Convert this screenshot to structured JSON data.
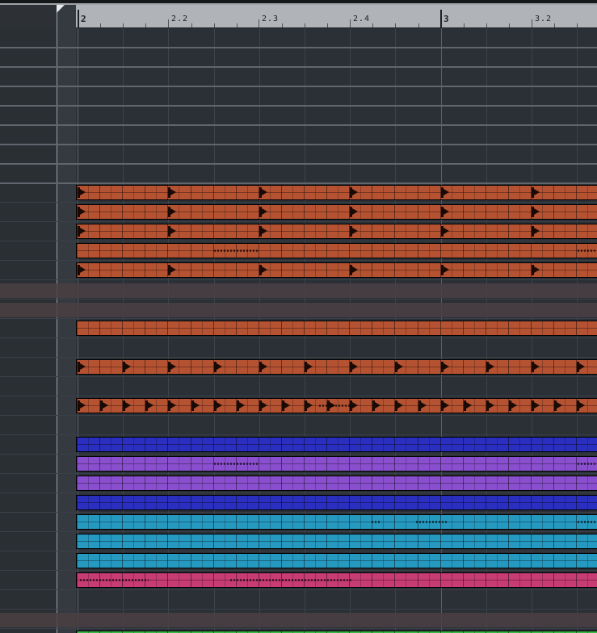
{
  "ruler": {
    "markers": [
      {
        "label": "2",
        "bar": true
      },
      {
        "label": "2.2",
        "bar": false
      },
      {
        "label": "2.3",
        "bar": false
      },
      {
        "label": "2.4",
        "bar": false
      },
      {
        "label": "3",
        "bar": true
      },
      {
        "label": "3.2",
        "bar": false
      }
    ]
  },
  "colors": {
    "orange": "#b55232",
    "blue": "#2a2fc0",
    "purple": "#8a4fcf",
    "cyan": "#2699c0",
    "pink": "#c83c74",
    "green": "#3cb84a",
    "band": "#4a3f43"
  },
  "tracks": [
    {
      "type": "empty"
    },
    {
      "type": "empty"
    },
    {
      "type": "empty"
    },
    {
      "type": "empty"
    },
    {
      "type": "empty"
    },
    {
      "type": "empty"
    },
    {
      "type": "empty"
    },
    {
      "type": "empty"
    },
    {
      "type": "clip",
      "color": "orange",
      "pattern": "kick"
    },
    {
      "type": "clip",
      "color": "orange",
      "pattern": "kick"
    },
    {
      "type": "clip",
      "color": "orange",
      "pattern": "kick"
    },
    {
      "type": "clip",
      "color": "orange",
      "pattern": "sparse"
    },
    {
      "type": "clip",
      "color": "orange",
      "pattern": "kick"
    },
    {
      "type": "band"
    },
    {
      "type": "band"
    },
    {
      "type": "clip",
      "color": "orange",
      "pattern": "plain"
    },
    {
      "type": "empty"
    },
    {
      "type": "clip",
      "color": "orange",
      "pattern": "eighth"
    },
    {
      "type": "empty"
    },
    {
      "type": "clip",
      "color": "orange",
      "pattern": "dense"
    },
    {
      "type": "empty"
    },
    {
      "type": "clip",
      "color": "blue",
      "pattern": "plain"
    },
    {
      "type": "clip",
      "color": "purple",
      "pattern": "sparse"
    },
    {
      "type": "clip",
      "color": "purple",
      "pattern": "plain"
    },
    {
      "type": "clip",
      "color": "blue",
      "pattern": "plain"
    },
    {
      "type": "clip",
      "color": "cyan",
      "pattern": "dots"
    },
    {
      "type": "clip",
      "color": "cyan",
      "pattern": "plain"
    },
    {
      "type": "clip",
      "color": "cyan",
      "pattern": "plain"
    },
    {
      "type": "clip",
      "color": "pink",
      "pattern": "busy"
    },
    {
      "type": "empty"
    },
    {
      "type": "band"
    },
    {
      "type": "clip",
      "color": "green",
      "pattern": "plain"
    }
  ]
}
